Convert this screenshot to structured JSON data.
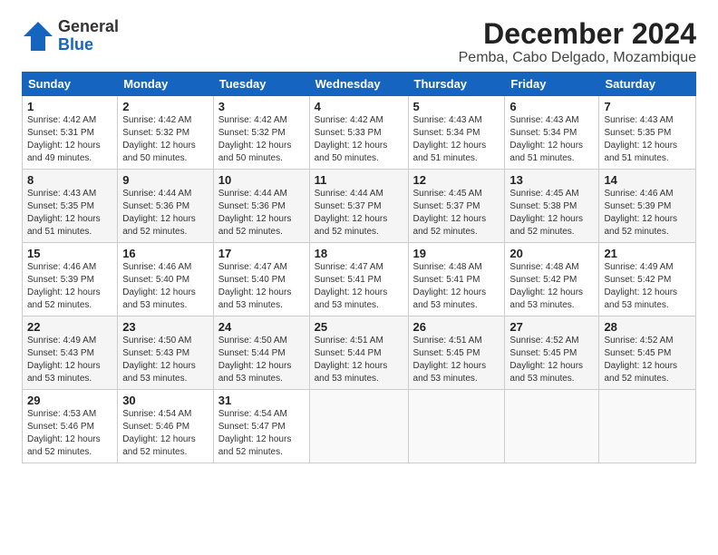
{
  "logo": {
    "general": "General",
    "blue": "Blue"
  },
  "title": "December 2024",
  "subtitle": "Pemba, Cabo Delgado, Mozambique",
  "columns": [
    "Sunday",
    "Monday",
    "Tuesday",
    "Wednesday",
    "Thursday",
    "Friday",
    "Saturday"
  ],
  "weeks": [
    [
      {
        "day": "1",
        "lines": [
          "Sunrise: 4:42 AM",
          "Sunset: 5:31 PM",
          "Daylight: 12 hours",
          "and 49 minutes."
        ]
      },
      {
        "day": "2",
        "lines": [
          "Sunrise: 4:42 AM",
          "Sunset: 5:32 PM",
          "Daylight: 12 hours",
          "and 50 minutes."
        ]
      },
      {
        "day": "3",
        "lines": [
          "Sunrise: 4:42 AM",
          "Sunset: 5:32 PM",
          "Daylight: 12 hours",
          "and 50 minutes."
        ]
      },
      {
        "day": "4",
        "lines": [
          "Sunrise: 4:42 AM",
          "Sunset: 5:33 PM",
          "Daylight: 12 hours",
          "and 50 minutes."
        ]
      },
      {
        "day": "5",
        "lines": [
          "Sunrise: 4:43 AM",
          "Sunset: 5:34 PM",
          "Daylight: 12 hours",
          "and 51 minutes."
        ]
      },
      {
        "day": "6",
        "lines": [
          "Sunrise: 4:43 AM",
          "Sunset: 5:34 PM",
          "Daylight: 12 hours",
          "and 51 minutes."
        ]
      },
      {
        "day": "7",
        "lines": [
          "Sunrise: 4:43 AM",
          "Sunset: 5:35 PM",
          "Daylight: 12 hours",
          "and 51 minutes."
        ]
      }
    ],
    [
      {
        "day": "8",
        "lines": [
          "Sunrise: 4:43 AM",
          "Sunset: 5:35 PM",
          "Daylight: 12 hours",
          "and 51 minutes."
        ]
      },
      {
        "day": "9",
        "lines": [
          "Sunrise: 4:44 AM",
          "Sunset: 5:36 PM",
          "Daylight: 12 hours",
          "and 52 minutes."
        ]
      },
      {
        "day": "10",
        "lines": [
          "Sunrise: 4:44 AM",
          "Sunset: 5:36 PM",
          "Daylight: 12 hours",
          "and 52 minutes."
        ]
      },
      {
        "day": "11",
        "lines": [
          "Sunrise: 4:44 AM",
          "Sunset: 5:37 PM",
          "Daylight: 12 hours",
          "and 52 minutes."
        ]
      },
      {
        "day": "12",
        "lines": [
          "Sunrise: 4:45 AM",
          "Sunset: 5:37 PM",
          "Daylight: 12 hours",
          "and 52 minutes."
        ]
      },
      {
        "day": "13",
        "lines": [
          "Sunrise: 4:45 AM",
          "Sunset: 5:38 PM",
          "Daylight: 12 hours",
          "and 52 minutes."
        ]
      },
      {
        "day": "14",
        "lines": [
          "Sunrise: 4:46 AM",
          "Sunset: 5:39 PM",
          "Daylight: 12 hours",
          "and 52 minutes."
        ]
      }
    ],
    [
      {
        "day": "15",
        "lines": [
          "Sunrise: 4:46 AM",
          "Sunset: 5:39 PM",
          "Daylight: 12 hours",
          "and 52 minutes."
        ]
      },
      {
        "day": "16",
        "lines": [
          "Sunrise: 4:46 AM",
          "Sunset: 5:40 PM",
          "Daylight: 12 hours",
          "and 53 minutes."
        ]
      },
      {
        "day": "17",
        "lines": [
          "Sunrise: 4:47 AM",
          "Sunset: 5:40 PM",
          "Daylight: 12 hours",
          "and 53 minutes."
        ]
      },
      {
        "day": "18",
        "lines": [
          "Sunrise: 4:47 AM",
          "Sunset: 5:41 PM",
          "Daylight: 12 hours",
          "and 53 minutes."
        ]
      },
      {
        "day": "19",
        "lines": [
          "Sunrise: 4:48 AM",
          "Sunset: 5:41 PM",
          "Daylight: 12 hours",
          "and 53 minutes."
        ]
      },
      {
        "day": "20",
        "lines": [
          "Sunrise: 4:48 AM",
          "Sunset: 5:42 PM",
          "Daylight: 12 hours",
          "and 53 minutes."
        ]
      },
      {
        "day": "21",
        "lines": [
          "Sunrise: 4:49 AM",
          "Sunset: 5:42 PM",
          "Daylight: 12 hours",
          "and 53 minutes."
        ]
      }
    ],
    [
      {
        "day": "22",
        "lines": [
          "Sunrise: 4:49 AM",
          "Sunset: 5:43 PM",
          "Daylight: 12 hours",
          "and 53 minutes."
        ]
      },
      {
        "day": "23",
        "lines": [
          "Sunrise: 4:50 AM",
          "Sunset: 5:43 PM",
          "Daylight: 12 hours",
          "and 53 minutes."
        ]
      },
      {
        "day": "24",
        "lines": [
          "Sunrise: 4:50 AM",
          "Sunset: 5:44 PM",
          "Daylight: 12 hours",
          "and 53 minutes."
        ]
      },
      {
        "day": "25",
        "lines": [
          "Sunrise: 4:51 AM",
          "Sunset: 5:44 PM",
          "Daylight: 12 hours",
          "and 53 minutes."
        ]
      },
      {
        "day": "26",
        "lines": [
          "Sunrise: 4:51 AM",
          "Sunset: 5:45 PM",
          "Daylight: 12 hours",
          "and 53 minutes."
        ]
      },
      {
        "day": "27",
        "lines": [
          "Sunrise: 4:52 AM",
          "Sunset: 5:45 PM",
          "Daylight: 12 hours",
          "and 53 minutes."
        ]
      },
      {
        "day": "28",
        "lines": [
          "Sunrise: 4:52 AM",
          "Sunset: 5:45 PM",
          "Daylight: 12 hours",
          "and 52 minutes."
        ]
      }
    ],
    [
      {
        "day": "29",
        "lines": [
          "Sunrise: 4:53 AM",
          "Sunset: 5:46 PM",
          "Daylight: 12 hours",
          "and 52 minutes."
        ]
      },
      {
        "day": "30",
        "lines": [
          "Sunrise: 4:54 AM",
          "Sunset: 5:46 PM",
          "Daylight: 12 hours",
          "and 52 minutes."
        ]
      },
      {
        "day": "31",
        "lines": [
          "Sunrise: 4:54 AM",
          "Sunset: 5:47 PM",
          "Daylight: 12 hours",
          "and 52 minutes."
        ]
      },
      null,
      null,
      null,
      null
    ]
  ]
}
